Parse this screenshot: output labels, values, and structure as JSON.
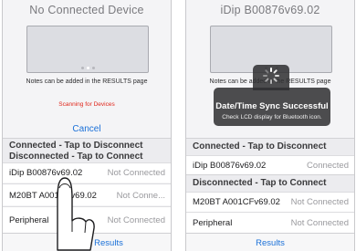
{
  "left_screen": {
    "title": "No Connected Device",
    "notes": "Notes can be added in the RESULTS page",
    "scanning": "Scanning for Devices",
    "cancel": "Cancel",
    "section_connected": "Connected - Tap to Disconnect",
    "section_disconnected": "Disconnected - Tap to Connect",
    "devices": [
      {
        "name": "iDip  B00876v69.02",
        "status": "Not Connected"
      },
      {
        "name": "M20BT  A001CFv69.02",
        "status": "Not Conne..."
      },
      {
        "name": "Peripheral",
        "status": "Not Connected"
      }
    ],
    "tab_results": "Results"
  },
  "right_screen": {
    "title": "iDip  B00876v69.02",
    "notes": "Notes can be added in the RESULTS page",
    "hud_title": "Date/Time Sync Successful",
    "hud_subtitle": "Check LCD display for Bluetooth icon.",
    "section_connected": "Connected - Tap to Disconnect",
    "connected_device": {
      "name": "iDip  B00876v69.02",
      "status": "Connected"
    },
    "section_disconnected": "Disconnected - Tap to Connect",
    "devices": [
      {
        "name": "M20BT  A001CFv69.02",
        "status": "Not Connected"
      },
      {
        "name": "Peripheral",
        "status": "Not Connected"
      }
    ],
    "tab_results": "Results"
  },
  "icons": {
    "finger": "tapping-hand-icon",
    "spinner": "activity-spinner-icon"
  },
  "colors": {
    "accent": "#1a70d8",
    "scanning": "#e0261b",
    "hud": "#303032"
  }
}
